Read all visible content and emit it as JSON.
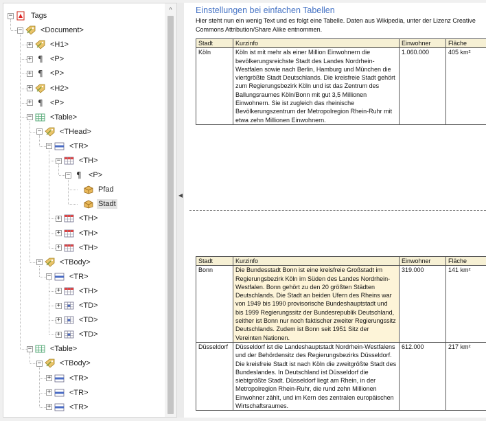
{
  "tree": {
    "nodes": [
      {
        "label": "Tags",
        "icon": "pdf-icon",
        "toggle": "−"
      },
      {
        "label": "<Document>",
        "icon": "tag-icon",
        "toggle": "−"
      },
      {
        "label": "<H1>",
        "icon": "tag-icon",
        "toggle": "+"
      },
      {
        "label": "<P>",
        "icon": "paragraph-icon",
        "toggle": "+"
      },
      {
        "label": "<P>",
        "icon": "paragraph-icon",
        "toggle": "+"
      },
      {
        "label": "<H2>",
        "icon": "tag-icon",
        "toggle": "+"
      },
      {
        "label": "<P>",
        "icon": "paragraph-icon",
        "toggle": "+"
      },
      {
        "label": "<Table>",
        "icon": "table-icon",
        "toggle": "−"
      },
      {
        "label": "<THead>",
        "icon": "tag-icon",
        "toggle": "−"
      },
      {
        "label": "<TR>",
        "icon": "table-row-icon",
        "toggle": "−"
      },
      {
        "label": "<TH>",
        "icon": "table-header-cell-icon",
        "toggle": "−"
      },
      {
        "label": "<P>",
        "icon": "paragraph-icon",
        "toggle": "−"
      },
      {
        "label": "Pfad",
        "icon": "content-box-icon",
        "toggle": ""
      },
      {
        "label": "Stadt",
        "icon": "content-box-icon",
        "toggle": ""
      },
      {
        "label": "<TH>",
        "icon": "table-header-cell-icon",
        "toggle": "+"
      },
      {
        "label": "<TH>",
        "icon": "table-header-cell-icon",
        "toggle": "+"
      },
      {
        "label": "<TH>",
        "icon": "table-header-cell-icon",
        "toggle": "+"
      },
      {
        "label": "<TBody>",
        "icon": "tag-icon",
        "toggle": "−"
      },
      {
        "label": "<TR>",
        "icon": "table-row-icon",
        "toggle": "−"
      },
      {
        "label": "<TH>",
        "icon": "table-header-cell-icon",
        "toggle": "+"
      },
      {
        "label": "<TD>",
        "icon": "table-cell-icon",
        "toggle": "+"
      },
      {
        "label": "<TD>",
        "icon": "table-cell-icon",
        "toggle": "+"
      },
      {
        "label": "<TD>",
        "icon": "table-cell-icon",
        "toggle": "+"
      },
      {
        "label": "<Table>",
        "icon": "table-icon",
        "toggle": "−"
      },
      {
        "label": "<TBody>",
        "icon": "tag-icon",
        "toggle": "−"
      },
      {
        "label": "<TR>",
        "icon": "table-row-icon",
        "toggle": "+"
      },
      {
        "label": "<TR>",
        "icon": "table-row-icon",
        "toggle": "+"
      },
      {
        "label": "<TR>",
        "icon": "table-row-icon",
        "toggle": "+"
      }
    ],
    "selected_label": "Stadt",
    "scroll_up_glyph": "^",
    "splitter_glyph": "◀"
  },
  "document": {
    "heading": "Einstellungen bei einfachen Tabellen",
    "intro": "Hier steht nun ein wenig Text und es folgt eine Tabelle. Daten aus Wikipedia, unter der Lizenz Creative Commons Attribution/Share Alike entnommen.",
    "table1": {
      "headers": [
        "Stadt",
        "Kurzinfo",
        "Einwohner",
        "Fläche"
      ],
      "rows": [
        {
          "stadt": "Köln",
          "kurzinfo": "Köln ist mit mehr als einer Million Einwohnern die bevölkerungsreichste Stadt des Landes Nordrhein-Westfalen sowie nach Berlin, Hamburg und München die viertgrößte Stadt Deutschlands. Die kreisfreie Stadt gehört zum Regierungsbezirk Köln und ist das Zentrum des Ballungsraumes Köln/Bonn mit gut 3,5 Millionen Einwohnern. Sie ist zugleich das rheinische Bevölkerungszentrum der Metropolregion Rhein-Ruhr mit etwa zehn Millionen Einwohnern.",
          "einwohner": "1.060.000",
          "flaeche": "405 km²"
        }
      ]
    },
    "table2": {
      "headers": [
        "Stadt",
        "Kurzinfo",
        "Einwohner",
        "Fläche"
      ],
      "rows": [
        {
          "stadt": "Bonn",
          "kurzinfo": "Die Bundesstadt Bonn ist eine kreisfreie Großstadt im Regierungsbezirk Köln im Süden des Landes Nordrhein-Westfalen. Bonn gehört zu den 20 größten Städten Deutschlands. Die Stadt an beiden Ufern des Rheins war von 1949 bis 1990 provisorische Bundeshauptstadt und bis 1999 Regierungssitz der Bundesrepublik Deutschland, seither ist Bonn nur noch faktischer zweiter Regierungssitz Deutschlands. Zudem ist Bonn seit 1951 Sitz der Vereinten Nationen.",
          "einwohner": "319.000",
          "flaeche": "141 km²"
        },
        {
          "stadt": "Düsseldorf",
          "kurzinfo": "Düsseldorf ist die Landeshauptstadt Nordrhein-Westfalens und der Behördensitz des Regierungsbezirks Düsseldorf. Die kreisfreie Stadt ist nach Köln die zweitgrößte Stadt des Bundeslandes. In Deutschland ist Düsseldorf die siebtgrößte Stadt. Düsseldorf liegt am Rhein, in der Metropolregion Rhein-Ruhr, die rund zehn Millionen Einwohner zählt, und im Kern des zentralen europäischen Wirtschaftsraumes.",
          "einwohner": "612.000",
          "flaeche": "217 km²"
        }
      ]
    }
  }
}
